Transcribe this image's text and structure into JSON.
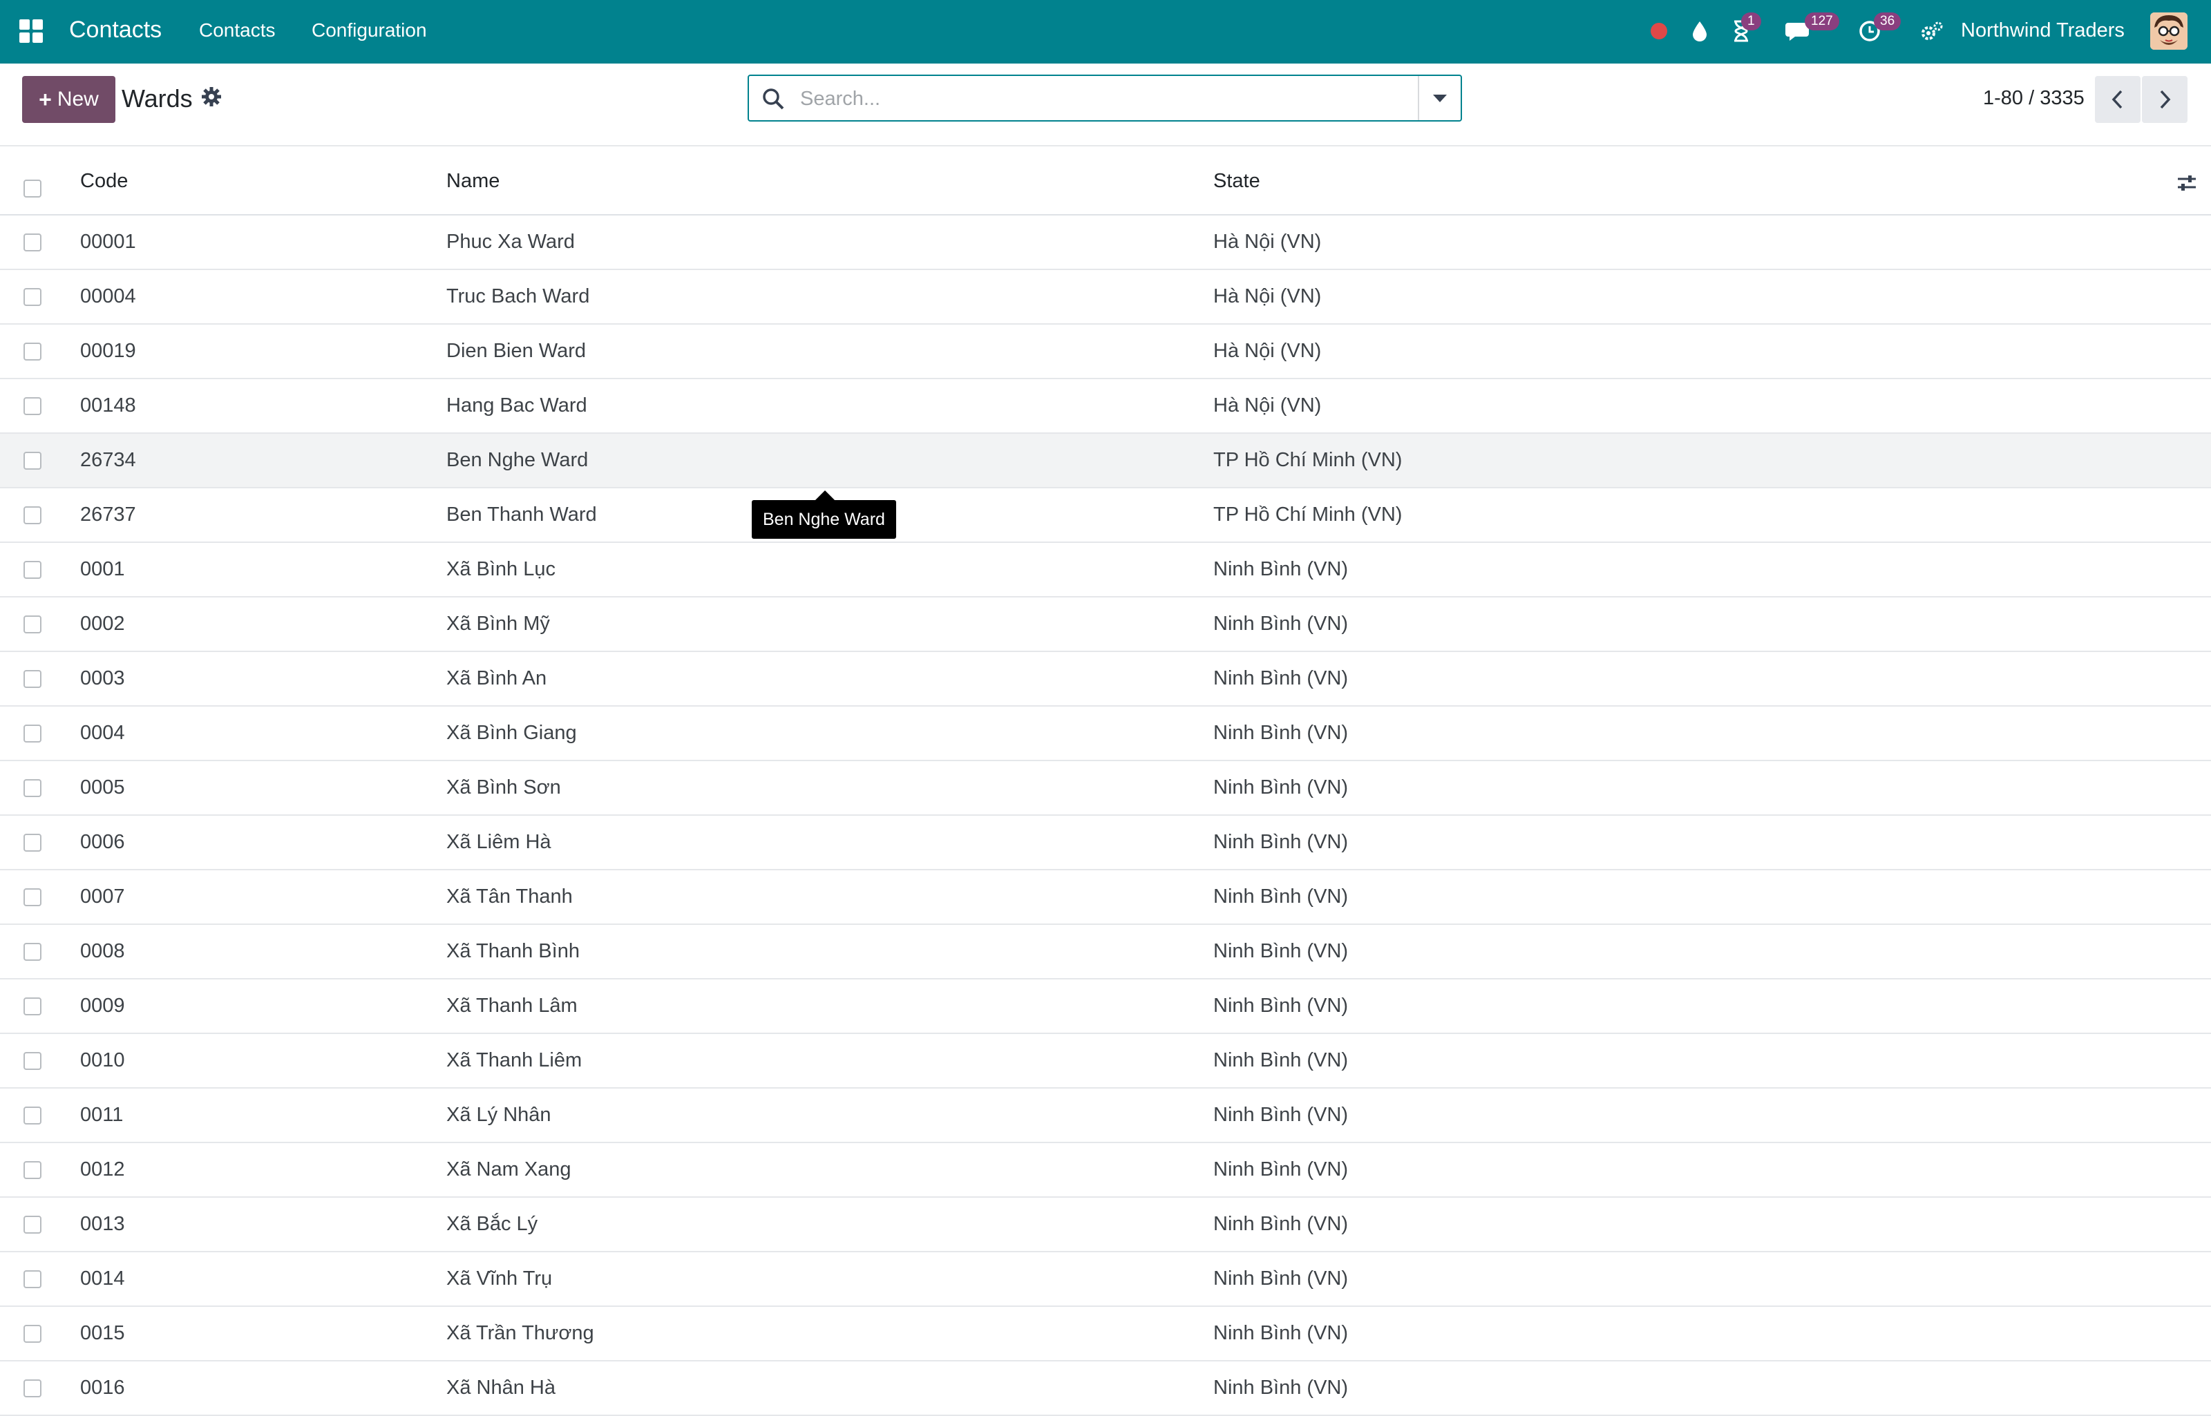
{
  "navbar": {
    "app_title": "Contacts",
    "menu": [
      "Contacts",
      "Configuration"
    ],
    "activity_badge": "1",
    "messages_badge": "127",
    "clock_badge": "36",
    "company": "Northwind Traders",
    "colors": {
      "bar": "#01828e",
      "badge": "#8a3f7f",
      "record_dot": "#e04848"
    }
  },
  "control_panel": {
    "new_label": "New",
    "title": "Wards",
    "search_placeholder": "Search...",
    "pager": "1-80 / 3335"
  },
  "list": {
    "columns": {
      "code": "Code",
      "name": "Name",
      "state": "State"
    },
    "rows": [
      {
        "code": "00001",
        "name": "Phuc Xa Ward",
        "state": "Hà Nội (VN)"
      },
      {
        "code": "00004",
        "name": "Truc Bach Ward",
        "state": "Hà Nội (VN)"
      },
      {
        "code": "00019",
        "name": "Dien Bien Ward",
        "state": "Hà Nội (VN)"
      },
      {
        "code": "00148",
        "name": "Hang Bac Ward",
        "state": "Hà Nội (VN)"
      },
      {
        "code": "26734",
        "name": "Ben Nghe Ward",
        "state": "TP Hồ Chí Minh (VN)"
      },
      {
        "code": "26737",
        "name": "Ben Thanh Ward",
        "state": "TP Hồ Chí Minh (VN)"
      },
      {
        "code": "0001",
        "name": "Xã Bình Lục",
        "state": "Ninh Bình (VN)"
      },
      {
        "code": "0002",
        "name": "Xã Bình Mỹ",
        "state": "Ninh Bình (VN)"
      },
      {
        "code": "0003",
        "name": "Xã Bình An",
        "state": "Ninh Bình (VN)"
      },
      {
        "code": "0004",
        "name": "Xã Bình Giang",
        "state": "Ninh Bình (VN)"
      },
      {
        "code": "0005",
        "name": "Xã Bình Sơn",
        "state": "Ninh Bình (VN)"
      },
      {
        "code": "0006",
        "name": "Xã Liêm Hà",
        "state": "Ninh Bình (VN)"
      },
      {
        "code": "0007",
        "name": "Xã Tân Thanh",
        "state": "Ninh Bình (VN)"
      },
      {
        "code": "0008",
        "name": "Xã Thanh Bình",
        "state": "Ninh Bình (VN)"
      },
      {
        "code": "0009",
        "name": "Xã Thanh Lâm",
        "state": "Ninh Bình (VN)"
      },
      {
        "code": "0010",
        "name": "Xã Thanh Liêm",
        "state": "Ninh Bình (VN)"
      },
      {
        "code": "0011",
        "name": "Xã Lý Nhân",
        "state": "Ninh Bình (VN)"
      },
      {
        "code": "0012",
        "name": "Xã Nam Xang",
        "state": "Ninh Bình (VN)"
      },
      {
        "code": "0013",
        "name": "Xã Bắc Lý",
        "state": "Ninh Bình (VN)"
      },
      {
        "code": "0014",
        "name": "Xã Vĩnh Trụ",
        "state": "Ninh Bình (VN)"
      },
      {
        "code": "0015",
        "name": "Xã Trần Thương",
        "state": "Ninh Bình (VN)"
      },
      {
        "code": "0016",
        "name": "Xã Nhân Hà",
        "state": "Ninh Bình (VN)"
      }
    ],
    "hovered_row": 4,
    "tooltip": "Ben Nghe Ward"
  }
}
